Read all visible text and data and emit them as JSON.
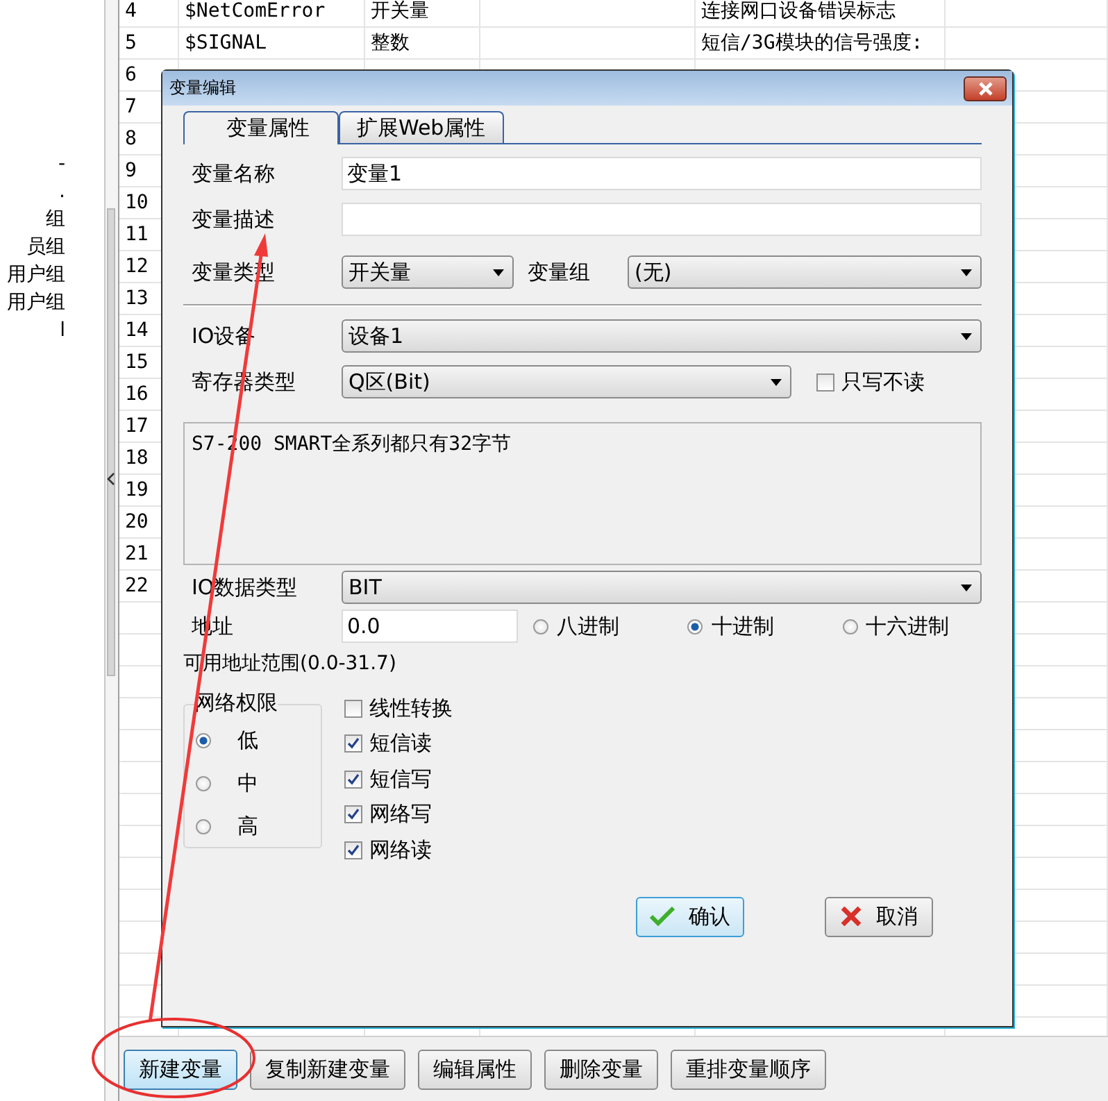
{
  "tree": {
    "items": [
      "-",
      ".",
      "组",
      "员组",
      "用户组",
      "用户组",
      "l"
    ]
  },
  "table": {
    "rows": [
      {
        "no": "4",
        "name": "$NetComError",
        "type": "开关量",
        "description": "连接网口设备错误标志"
      },
      {
        "no": "5",
        "name": "$SIGNAL",
        "type": "整数",
        "description": "短信/3G模块的信号强度:"
      },
      {
        "no": "6"
      },
      {
        "no": "7"
      },
      {
        "no": "8"
      },
      {
        "no": "9"
      },
      {
        "no": "10"
      },
      {
        "no": "11"
      },
      {
        "no": "12"
      },
      {
        "no": "13"
      },
      {
        "no": "14"
      },
      {
        "no": "15"
      },
      {
        "no": "16"
      },
      {
        "no": "17"
      },
      {
        "no": "18"
      },
      {
        "no": "19"
      },
      {
        "no": "20"
      },
      {
        "no": "21"
      },
      {
        "no": "22"
      }
    ]
  },
  "dialog": {
    "title": "变量编辑",
    "tabs": [
      {
        "label": "变量属性",
        "selected": true
      },
      {
        "label": "扩展Web属性",
        "selected": false
      }
    ],
    "name": {
      "label": "变量名称",
      "value": "变量1"
    },
    "description": {
      "label": "变量描述"
    },
    "type": {
      "label": "变量类型",
      "value": "开关量"
    },
    "group": {
      "label": "变量组",
      "value": "(无)"
    },
    "io_device": {
      "label": "IO设备",
      "value": "设备1"
    },
    "register": {
      "label": "寄存器类型",
      "value": "Q区(Bit)"
    },
    "write_only": {
      "label": "只写不读",
      "checked": false
    },
    "note": "S7-200 SMART全系列都只有32字节",
    "io_data_type": {
      "label": "IO数据类型",
      "value": "BIT"
    },
    "address": {
      "label": "地址",
      "value": "0.0"
    },
    "radix": [
      {
        "label": "八进制",
        "selected": false
      },
      {
        "label": "十进制",
        "selected": true
      },
      {
        "label": "十六进制",
        "selected": false
      }
    ],
    "range": "可用地址范围(0.0-31.7)",
    "permission": {
      "title": "网络权限",
      "options": [
        {
          "label": "低",
          "selected": true
        },
        {
          "label": "中",
          "selected": false
        },
        {
          "label": "高",
          "selected": false
        }
      ]
    },
    "options": [
      {
        "label": "线性转换",
        "checked": false
      },
      {
        "label": "短信读",
        "checked": true
      },
      {
        "label": "短信写",
        "checked": true
      },
      {
        "label": "网络写",
        "checked": true
      },
      {
        "label": "网络读",
        "checked": true
      }
    ],
    "ok": "确认",
    "cancel": "取消"
  },
  "buttons": [
    {
      "label": "新建变量",
      "focused": true
    },
    {
      "label": "复制新建变量",
      "focused": false
    },
    {
      "label": "编辑属性",
      "focused": false
    },
    {
      "label": "删除变量",
      "focused": false
    },
    {
      "label": "重排变量顺序",
      "focused": false
    }
  ]
}
